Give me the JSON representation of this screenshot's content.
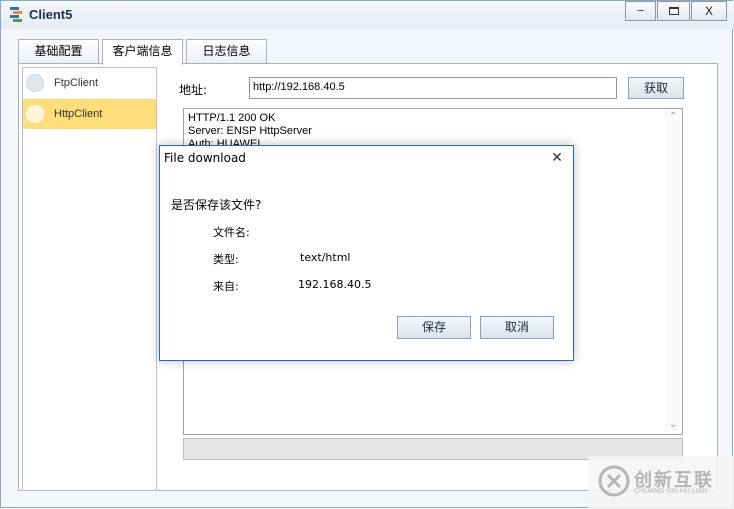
{
  "window": {
    "title": "Client5",
    "minimize_glyph": "─",
    "close_glyph": "X"
  },
  "tabs": [
    {
      "label": "基础配置"
    },
    {
      "label": "客户端信息",
      "active": true
    },
    {
      "label": "日志信息"
    }
  ],
  "sidebar": {
    "items": [
      {
        "label": "FtpClient",
        "selected": false
      },
      {
        "label": "HttpClient",
        "selected": true
      }
    ]
  },
  "request": {
    "address_label": "地址:",
    "url": "http://192.168.40.5",
    "fetch_label": "获取"
  },
  "response": {
    "lines": [
      "HTTP/1.1 200 OK",
      "Server: ENSP HttpServer",
      "Auth: HUAWEI"
    ]
  },
  "dialog": {
    "title": "File download",
    "close_glyph": "✕",
    "question": "是否保存该文件?",
    "filename_label": "文件名:",
    "filename_value": "",
    "type_label": "类型:",
    "type_value": "text/html",
    "from_label": "来自:",
    "from_value": "192.168.40.5",
    "save_label": "保存",
    "cancel_label": "取消"
  },
  "watermark": {
    "title": "创新互联",
    "subtitle": "CHUANG XIN HU LIAN"
  },
  "colors": {
    "selected_item_bg": "#ffde7a",
    "dialog_border": "#1b6cc1",
    "titlebar_text": "#15315a"
  }
}
